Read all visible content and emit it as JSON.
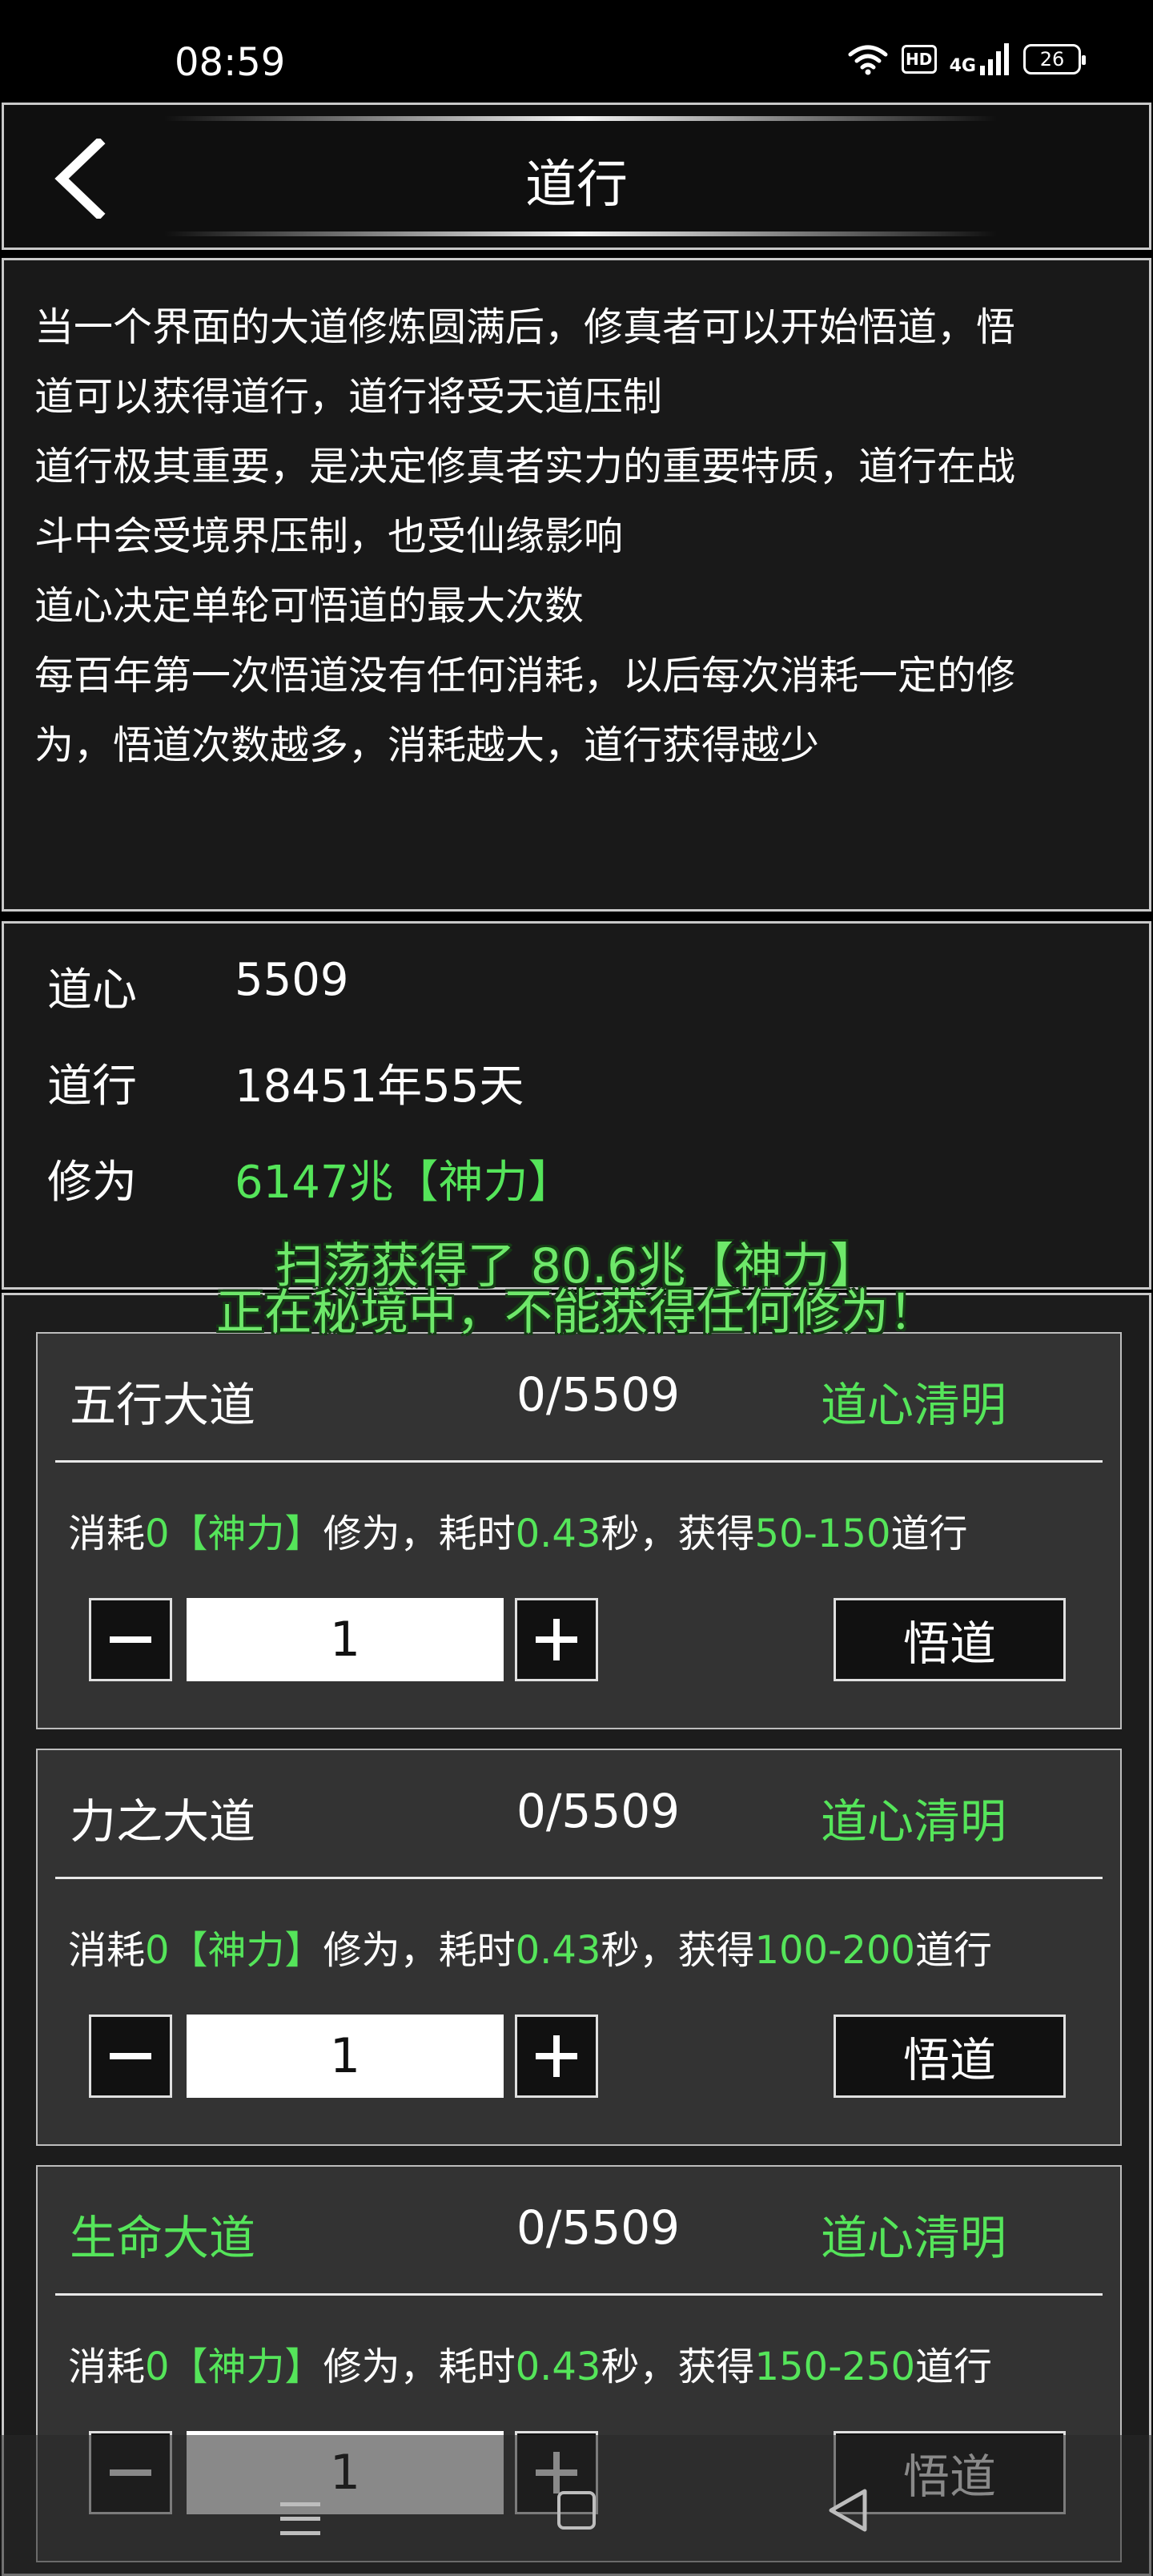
{
  "status_bar": {
    "time": "08:59",
    "hd_label": "HD",
    "network_label": "4G",
    "battery": "26",
    "icons": [
      "wifi-icon",
      "hd-icon",
      "signal-icon",
      "battery-icon"
    ]
  },
  "header": {
    "title": "道行",
    "back_icon": "chevron-left-icon"
  },
  "description": {
    "lines": [
      "当一个界面的大道修炼圆满后，修真者可以开始悟道，悟",
      "道可以获得道行，道行将受天道压制",
      "道行极其重要，是决定修真者实力的重要特质，道行在战",
      "斗中会受境界压制，也受仙缘影响",
      "道心决定单轮可悟道的最大次数",
      "每百年第一次悟道没有任何消耗，以后每次消耗一定的修",
      "为，悟道次数越多，消耗越大，道行获得越少"
    ]
  },
  "stats": {
    "daoxin_label": "道心",
    "daoxin_value": "5509",
    "daoxing_label": "道行",
    "daoxing_value": "18451年55天",
    "xiuwei_label": "修为",
    "xiuwei_value": "6147兆【神力】"
  },
  "notices": {
    "sweep": "扫荡获得了 80.6兆【神力】",
    "secret_realm": "正在秘境中，不能获得任何修为！"
  },
  "cards": [
    {
      "name": "五行大道",
      "progress": "0/5509",
      "state": "道心清明",
      "cost_prefix": "消耗",
      "cost_value": "0【神力】",
      "cost_mid": "修为，耗时",
      "time_value": "0.43",
      "time_suffix": "秒，获得",
      "gain_value": "50-150",
      "gain_suffix": "道行",
      "quantity": "1",
      "button_label": "悟道"
    },
    {
      "name": "力之大道",
      "progress": "0/5509",
      "state": "道心清明",
      "cost_prefix": "消耗",
      "cost_value": "0【神力】",
      "cost_mid": "修为，耗时",
      "time_value": "0.43",
      "time_suffix": "秒，获得",
      "gain_value": "100-200",
      "gain_suffix": "道行",
      "quantity": "1",
      "button_label": "悟道"
    },
    {
      "name": "生命大道",
      "progress": "0/5509",
      "state": "道心清明",
      "cost_prefix": "消耗",
      "cost_value": "0【神力】",
      "cost_mid": "修为，耗时",
      "time_value": "0.43",
      "time_suffix": "秒，获得",
      "gain_value": "150-250",
      "gain_suffix": "道行",
      "quantity": "1",
      "button_label": "悟道"
    }
  ],
  "nav_bar": {
    "icons": [
      "menu-icon",
      "home-icon",
      "back-triangle-icon"
    ]
  },
  "colors": {
    "accent_green": "#55e55a",
    "panel_bg": "#191919",
    "card_bg": "#333333",
    "border": "#c9c9c9"
  }
}
